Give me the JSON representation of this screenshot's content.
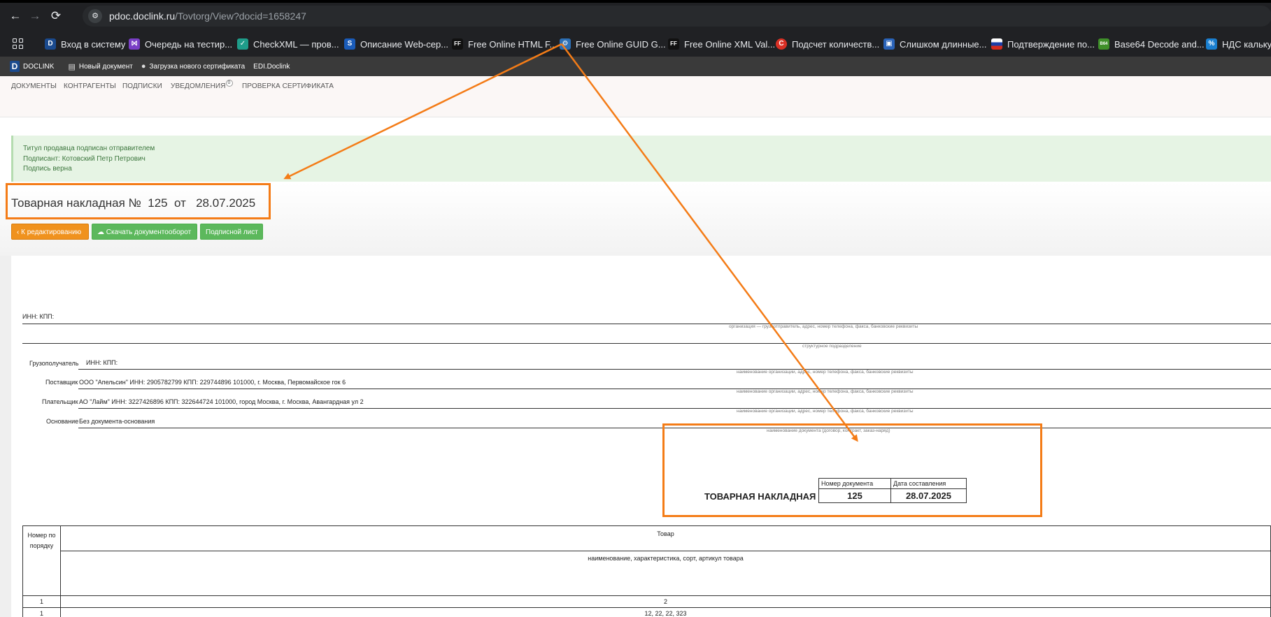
{
  "browser": {
    "url_host": "pdoc.doclink.ru",
    "url_path": "/Tovtorg/View?docid=1658247",
    "bookmarks": [
      {
        "label": "Вход в систему",
        "icon": "D",
        "color": "#1a4a8e"
      },
      {
        "label": "Очередь на тестир...",
        "icon": "⨝",
        "color": "#7a3fc6"
      },
      {
        "label": "CheckXML — пров...",
        "icon": "✓",
        "color": "#1f9d8a"
      },
      {
        "label": "Описание Web-сер...",
        "icon": "S",
        "color": "#1a5bb8"
      },
      {
        "label": "Free Online HTML F...",
        "icon": "FF",
        "color": "#111111"
      },
      {
        "label": "Free Online GUID G...",
        "icon": "⚙",
        "color": "#2c6fb5"
      },
      {
        "label": "Free Online XML Val...",
        "icon": "FF",
        "color": "#111111"
      },
      {
        "label": "Подсчет количеств...",
        "icon": "C",
        "color": "#d93025"
      },
      {
        "label": "Слишком длинные...",
        "icon": "▣",
        "color": "#2a63b8"
      },
      {
        "label": "Подтверждение по...",
        "icon": "▬",
        "color": "#d52b1e"
      },
      {
        "label": "Base64 Decode and...",
        "icon": "B64",
        "color": "#3f8f29"
      },
      {
        "label": "НДС калькул",
        "icon": "%",
        "color": "#1a7fd0"
      }
    ]
  },
  "app": {
    "logo": "DOCLINK",
    "top_items": [
      "Новый документ",
      "Загрузка нового сертификата",
      "EDI.Doclink"
    ],
    "menu": {
      "documents": "ДОКУМЕНТЫ",
      "counterparties": "КОНТРАГЕНТЫ",
      "subscriptions": "ПОДПИСКИ",
      "notifications": "УВЕДОМЛЕНИЯ",
      "notifications_count": "0",
      "check_cert": "ПРОВЕРКА СЕРТИФИКАТА"
    }
  },
  "status": {
    "line1": "Титул продавца подписан отправителем",
    "line2": "Подписант: Котовский Петр Петрович",
    "line3": "Подпись верна"
  },
  "doc_header": {
    "title": "Товарная накладная №  125  от   28.07.2025"
  },
  "buttons": {
    "edit": "‹  К редактированию",
    "download": "Скачать документооборот",
    "signing_sheet": "Подписной лист"
  },
  "document": {
    "inn_kpp": "ИНН: КПП:",
    "cap_org_sender": "организация — грузоотправитель, адрес, номер телефона, факса, банковские реквизиты",
    "cap_division": "структурное подразделение",
    "consignee_label": "Грузополучатель",
    "consignee_value": "ИНН: КПП:",
    "cap_org": "наименование организации, адрес, номер телефона, факса, банковские реквизиты",
    "supplier_label": "Поставщик",
    "supplier_value": "ООО \"Апельсин\" ИНН: 2905782799 КПП: 229744896 101000, г. Москва, Первомайское гок 6",
    "payer_label": "Плательщик",
    "payer_value": "АО \"Лайм\"     ИНН: 3227426896 КПП: 322644724 101000, город Москва, г. Москва, Авангардная ул 2",
    "basis_label": "Основание",
    "basis_value": "Без документа-основания",
    "cap_basis": "наименование документа (договор, контракт, заказ-наряд)",
    "form_title": "ТОВАРНАЯ НАКЛАДНАЯ",
    "docno_header": "Номер документа",
    "date_header": "Дата составления",
    "docno_value": "125",
    "date_value": "28.07.2025"
  },
  "goods_table": {
    "col_num": "Номер по порядку",
    "col_goods": "Товар",
    "col_goods_sub": "наименование, характеристика, сорт, артикул товара",
    "row_index": [
      "1",
      "2"
    ],
    "row1": [
      "1",
      "12, 22, 22, 323"
    ]
  },
  "colors": {
    "annotation": "#f47c17",
    "success_bg": "#e6f4e4",
    "button_orange": "#f0921e",
    "button_green": "#5cb85c"
  }
}
